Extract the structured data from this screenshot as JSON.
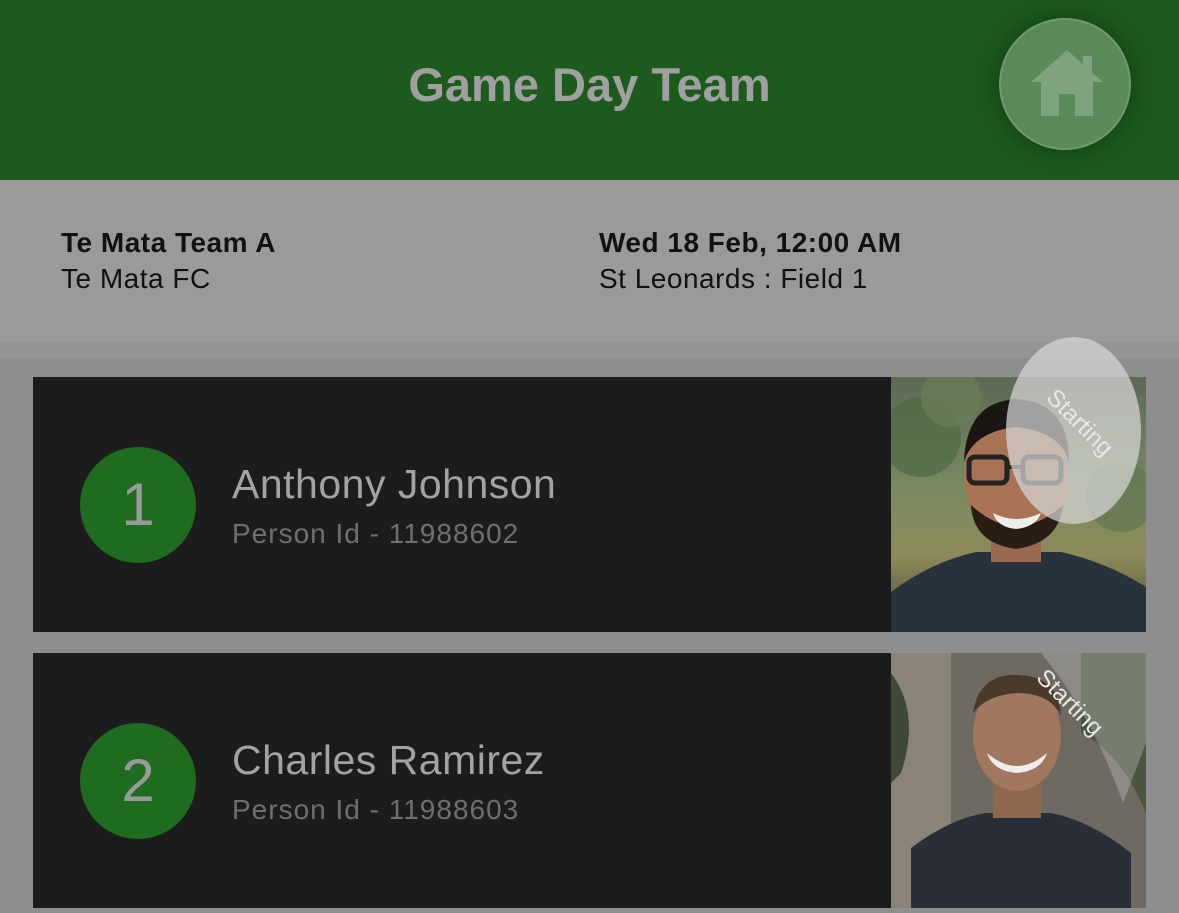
{
  "header": {
    "title": "Game Day Team",
    "home_icon": "home-icon"
  },
  "match": {
    "team_name": "Te Mata Team A",
    "club_name": "Te Mata FC",
    "date_time": "Wed 18 Feb, 12:00 AM",
    "venue": "St Leonards : Field 1"
  },
  "players": [
    {
      "number": "1",
      "name": "Anthony Johnson",
      "person_id": "Person Id - 11988602",
      "status": "Starting"
    },
    {
      "number": "2",
      "name": "Charles Ramirez",
      "person_id": "Person Id - 11988603",
      "status": "Starting"
    }
  ],
  "colors": {
    "header_green": "#1d5a1d",
    "number_green": "#1f6b1f",
    "card_bg": "#1c1c1c",
    "page_bg": "#8e8e8e"
  }
}
